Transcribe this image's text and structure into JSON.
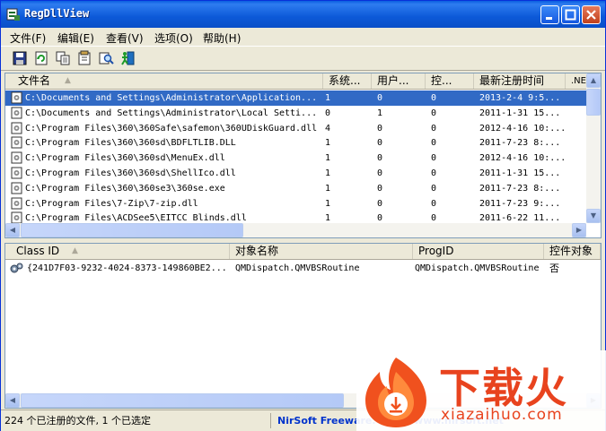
{
  "window": {
    "title": "RegDllView"
  },
  "menu": [
    {
      "label": "文件(F)"
    },
    {
      "label": "编辑(E)"
    },
    {
      "label": "查看(V)"
    },
    {
      "label": "选项(O)"
    },
    {
      "label": "帮助(H)"
    }
  ],
  "toolbar": {
    "icons": [
      "save-icon",
      "refresh-icon",
      "copy-icon",
      "properties-icon",
      "search-icon",
      "exit-icon"
    ]
  },
  "top_table": {
    "columns": [
      "文件名",
      "系统...",
      "用户...",
      "控...",
      "最新注册时间",
      ".NE"
    ],
    "rows": [
      {
        "file": "C:\\Documents and Settings\\Administrator\\Application...",
        "sys": "1",
        "user": "0",
        "ctrl": "0",
        "time": "2013-2-4 9:5..."
      },
      {
        "file": "C:\\Documents and Settings\\Administrator\\Local Setti...",
        "sys": "0",
        "user": "1",
        "ctrl": "0",
        "time": "2011-1-31 15..."
      },
      {
        "file": "C:\\Program Files\\360\\360Safe\\safemon\\360UDiskGuard.dll",
        "sys": "4",
        "user": "0",
        "ctrl": "0",
        "time": "2012-4-16 10:..."
      },
      {
        "file": "C:\\Program Files\\360\\360sd\\BDFLTLIB.DLL",
        "sys": "1",
        "user": "0",
        "ctrl": "0",
        "time": "2011-7-23 8:..."
      },
      {
        "file": "C:\\Program Files\\360\\360sd\\MenuEx.dll",
        "sys": "1",
        "user": "0",
        "ctrl": "0",
        "time": "2012-4-16 10:..."
      },
      {
        "file": "C:\\Program Files\\360\\360sd\\ShellIco.dll",
        "sys": "1",
        "user": "0",
        "ctrl": "0",
        "time": "2011-1-31 15..."
      },
      {
        "file": "C:\\Program Files\\360\\360se3\\360se.exe",
        "sys": "1",
        "user": "0",
        "ctrl": "0",
        "time": "2011-7-23 8:..."
      },
      {
        "file": "C:\\Program Files\\7-Zip\\7-zip.dll",
        "sys": "1",
        "user": "0",
        "ctrl": "0",
        "time": "2011-7-23 9:..."
      },
      {
        "file": "C:\\Program Files\\ACDSee5\\EITCC Blinds.dll",
        "sys": "1",
        "user": "0",
        "ctrl": "0",
        "time": "2011-6-22 11..."
      }
    ]
  },
  "bottom_table": {
    "columns": [
      "Class ID",
      "对象名称",
      "ProgID",
      "控件对象"
    ],
    "rows": [
      {
        "clsid": "{241D7F03-9232-4024-8373-149860BE2...",
        "name": "QMDispatch.QMVBSRoutine",
        "progid": "QMDispatch.QMVBSRoutine",
        "ctrl": "否"
      }
    ]
  },
  "status": {
    "count": "224 个已注册的文件, 1 个已选定",
    "link": "NirSoft Freeware.  http://www.nirsoft.net"
  },
  "watermark": {
    "brand": "下载火",
    "url": "xiazaihuo.com"
  },
  "colors": {
    "selection": "#316ac5",
    "title_bar": "#0a5fe0",
    "link": "#0033cc",
    "watermark": "#e8431e"
  }
}
